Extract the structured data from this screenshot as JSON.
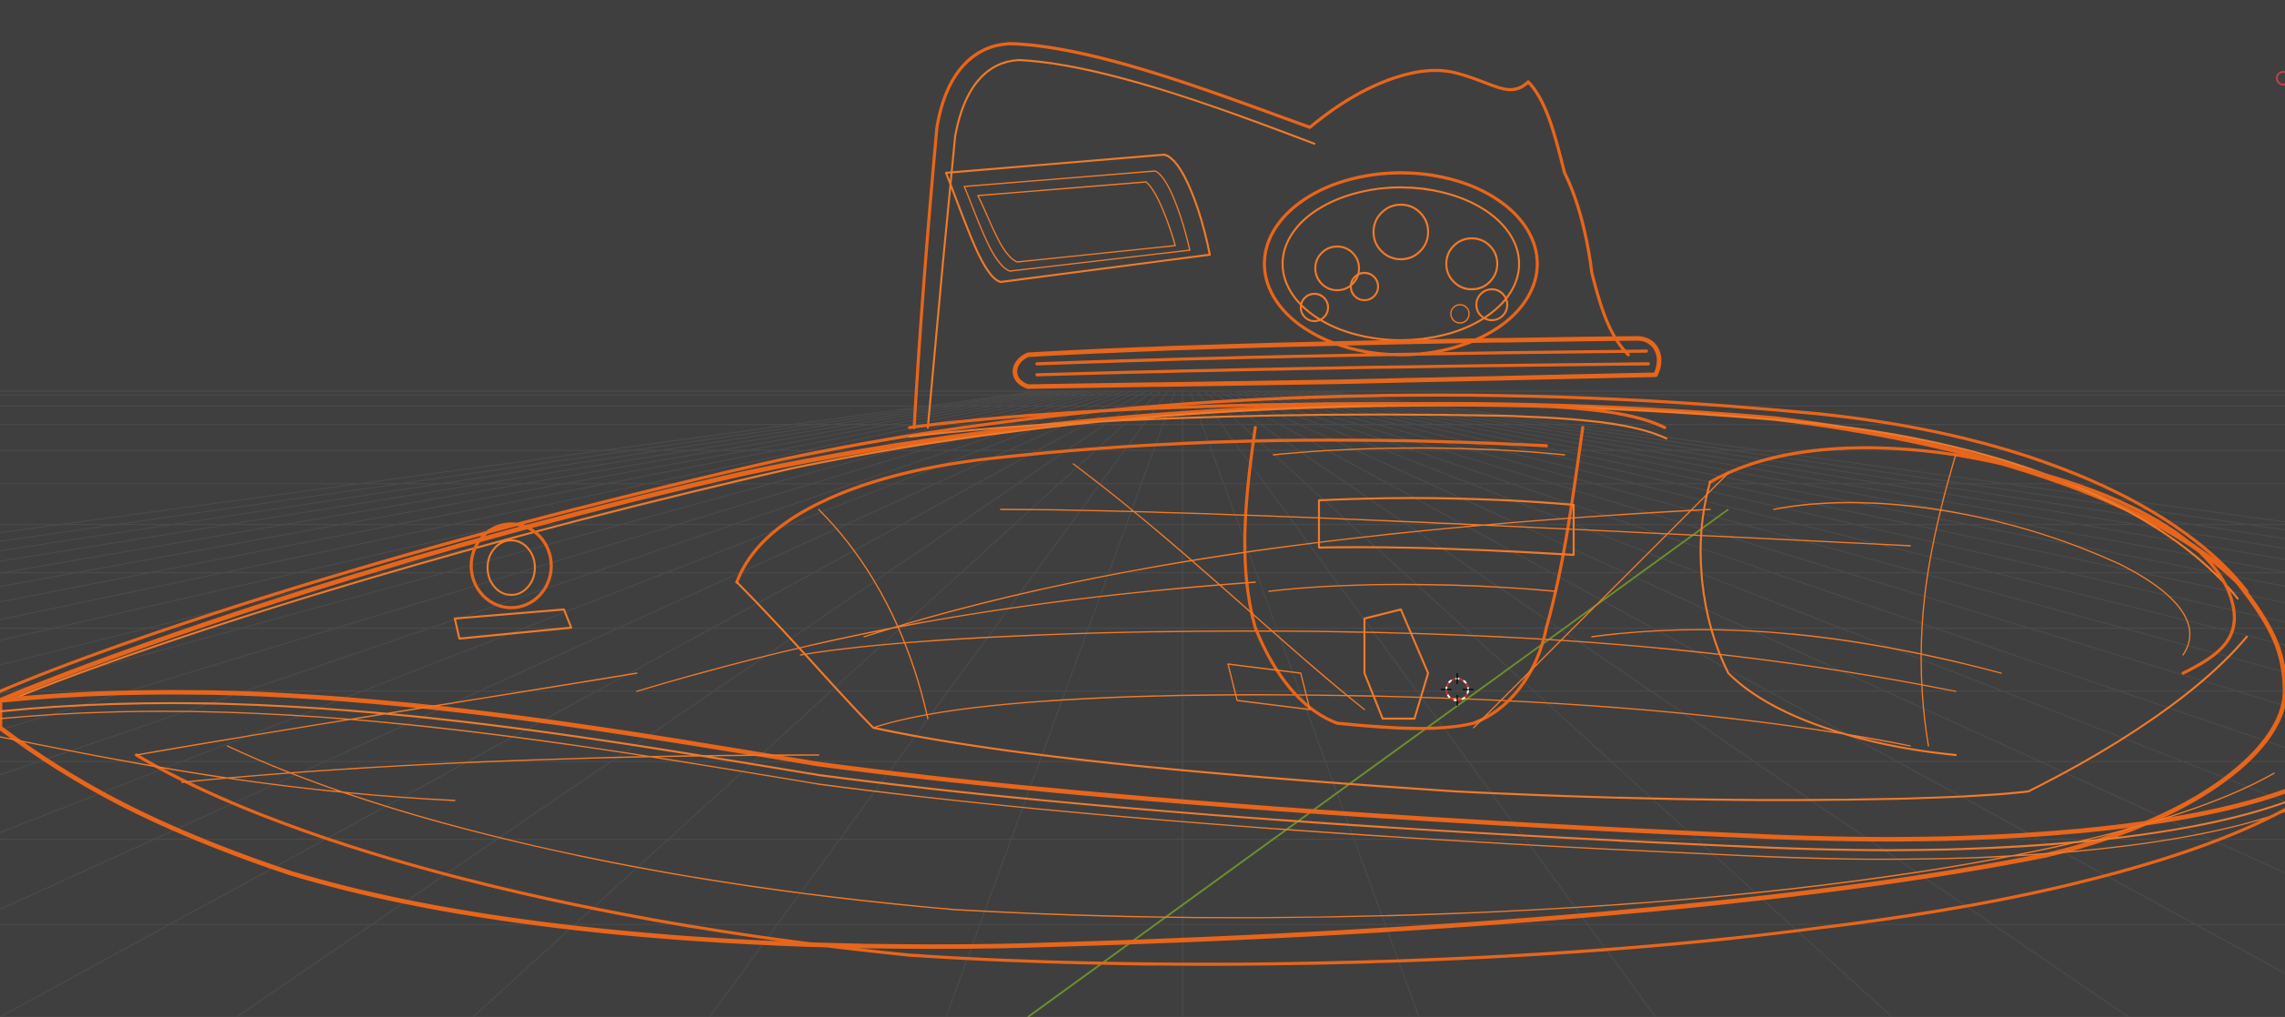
{
  "viewport": {
    "name": "3D Viewport",
    "shading": "wireframe",
    "background_color": "#3f3f3f",
    "grid_color": "#4a4a4a",
    "wire_color": "#e8651a",
    "wire_highlight_color": "#f07a2a",
    "y_axis_color": "#6b8f2e",
    "cursor_icon": "3d-cursor-icon",
    "object": "selected-mesh-wireframe"
  }
}
